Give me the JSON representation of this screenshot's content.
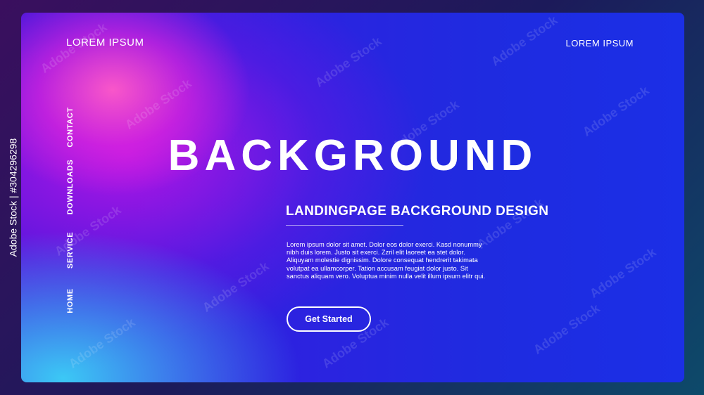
{
  "stock": {
    "id_text": "Adobe Stock | #304296298"
  },
  "header": {
    "left_label": "LOREM IPSUM",
    "right_label": "LOREM IPSUM"
  },
  "sidenav": {
    "items": [
      {
        "label": "HOME"
      },
      {
        "label": "SERVICE"
      },
      {
        "label": "DOWNLOADS"
      },
      {
        "label": "CONTACT"
      }
    ]
  },
  "hero": {
    "title": "BACKGROUND",
    "subtitle": "LANDINGPAGE BACKGROUND DESIGN",
    "body": "Lorem ipsum dolor sit amet. Dolor eos dolor exerci. Kasd nonummy nibh duis lorem. Justo sit exerci. Zzril elit laoreet ea stet dolor. Aliquyam molestie dignissim. Dolore consequat hendrerit takimata volutpat ea ullamcorper. Tation accusam feugiat dolor justo. Sit sanctus aliquam vero. Voluptua minim nulla velit illum ipsum elitr qui.",
    "cta_label": "Get Started"
  },
  "watermark": {
    "text": "Adobe Stock"
  },
  "colors": {
    "accent_pink": "#ff5ac8",
    "accent_blue": "#1f2be0",
    "accent_cyan": "#3cc8f5",
    "text": "#ffffff"
  }
}
